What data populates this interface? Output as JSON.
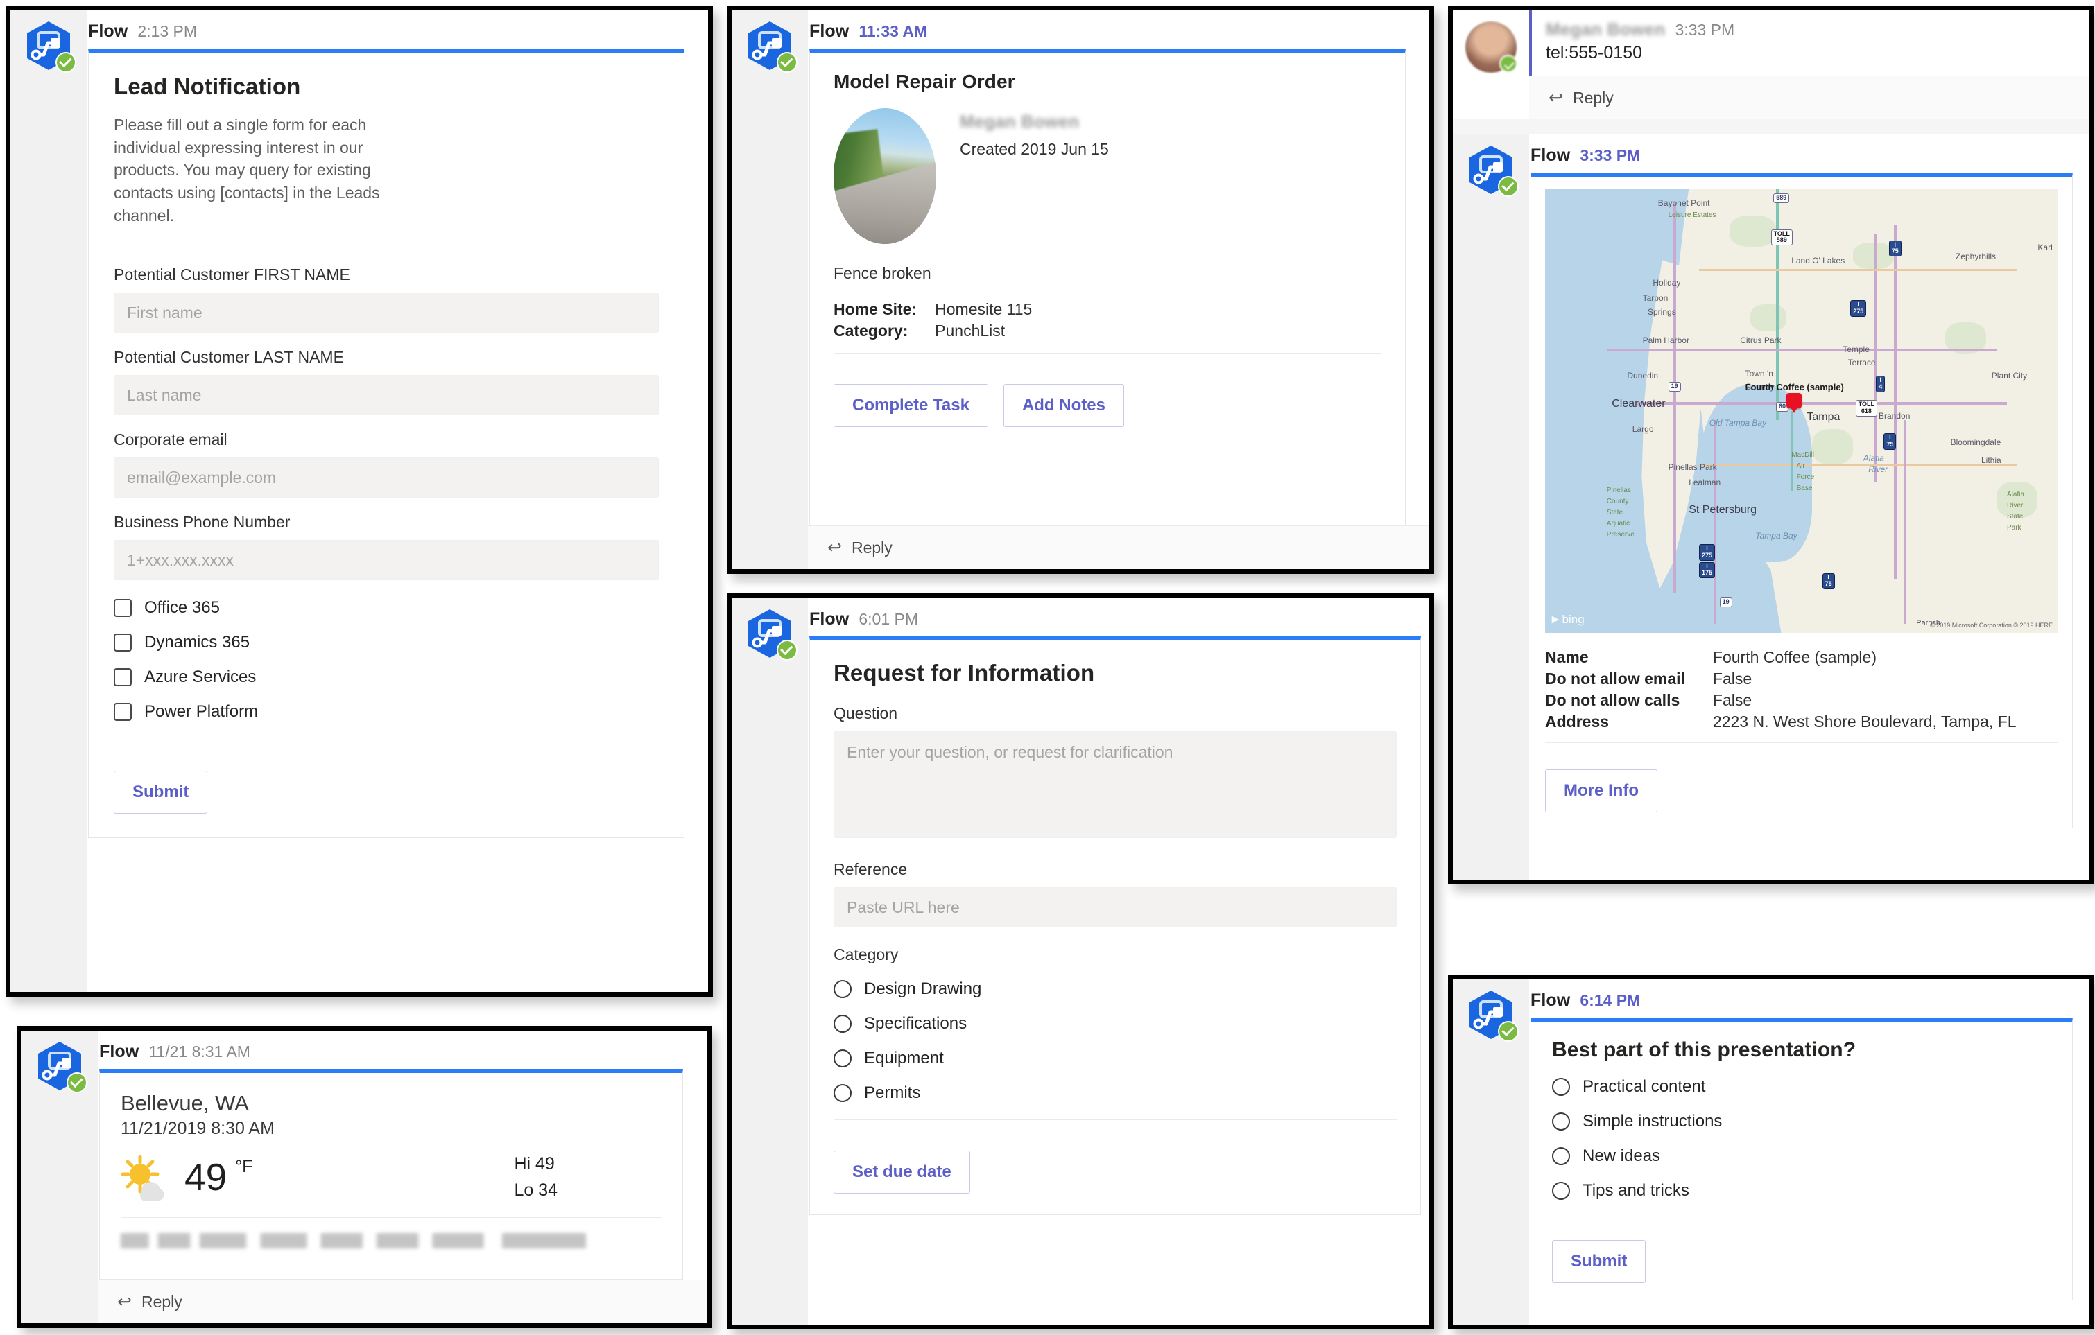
{
  "app": {
    "bot_name": "Flow",
    "bot_icon": "microsoft-flow-icon",
    "verified_badge": "green-check-badge"
  },
  "cards": {
    "lead_notification": {
      "bot_name": "Flow",
      "timestamp": "2:13 PM",
      "title": "Lead Notification",
      "description": "Please fill out a single form for each individual expressing interest in our products. You may query for existing contacts using [contacts] in the Leads channel.",
      "fields": [
        {
          "label": "Potential Customer FIRST NAME",
          "placeholder": "First name",
          "value": ""
        },
        {
          "label": "Potential Customer LAST NAME",
          "placeholder": "Last name",
          "value": ""
        },
        {
          "label": "Corporate email",
          "placeholder": "email@example.com",
          "value": ""
        },
        {
          "label": "Business Phone Number",
          "placeholder": "1+xxx.xxx.xxxx",
          "value": ""
        }
      ],
      "checkboxes": [
        {
          "label": "Office 365",
          "checked": false
        },
        {
          "label": "Dynamics 365",
          "checked": false
        },
        {
          "label": "Azure Services",
          "checked": false
        },
        {
          "label": "Power Platform",
          "checked": false
        }
      ],
      "submit_label": "Submit"
    },
    "weather": {
      "bot_name": "Flow",
      "timestamp": "11/21 8:31 AM",
      "location": "Bellevue, WA",
      "datetime": "11/21/2019 8:30 AM",
      "temperature": "49",
      "unit": "°F",
      "high": "Hi 49",
      "low": "Lo 34",
      "weather_icon": "sun-behind-cloud-icon",
      "reply_label": "Reply"
    },
    "repair_order": {
      "bot_name": "Flow",
      "timestamp": "11:33 AM",
      "title": "Model Repair Order",
      "person_name": "Megan Bowen",
      "created": "Created 2019 Jun 15",
      "issue": "Fence broken",
      "details": [
        {
          "key": "Home Site:",
          "value": "Homesite 115"
        },
        {
          "key": "Category:",
          "value": "PunchList"
        }
      ],
      "buttons": [
        "Complete Task",
        "Add Notes"
      ],
      "reply_label": "Reply"
    },
    "request_info": {
      "bot_name": "Flow",
      "timestamp": "6:01 PM",
      "title": "Request for Information",
      "question_label": "Question",
      "question_placeholder": "Enter your question, or request for clarification",
      "reference_label": "Reference",
      "reference_placeholder": "Paste URL here",
      "category_label": "Category",
      "category_options": [
        "Design Drawing",
        "Specifications",
        "Equipment",
        "Permits"
      ],
      "button_label": "Set due date"
    },
    "contact_map": {
      "message": {
        "author": "Megan Bowen",
        "timestamp": "3:33 PM",
        "text": "tel:555-0150",
        "reply_label": "Reply",
        "avatar": "user-avatar"
      },
      "bot_name": "Flow",
      "timestamp": "3:33 PM",
      "map": {
        "provider": "bing",
        "attribution": "© 2019 Microsoft Corporation © 2019 HERE",
        "pin_label": "Fourth Coffee (sample)",
        "places": [
          "Bayonet Point",
          "Leisure Estates",
          "Land O' Lakes",
          "Zephyrhills",
          "Karl",
          "Holiday",
          "Tarpon Springs",
          "Palm Harbor",
          "Citrus Park",
          "Temple Terrace",
          "Dunedin",
          "Town 'n Country",
          "Plant City",
          "Clearwater",
          "Tampa",
          "Brandon",
          "Largo",
          "Old Tampa Bay",
          "Bloomingdale",
          "Lithia",
          "Pinellas Park",
          "Lealman",
          "MacDill Air Force Base",
          "Alafia River",
          "Pinellas County State Aquatic Preserve",
          "St Petersburg",
          "Tampa Bay",
          "Alafia River State Park",
          "Parrish"
        ],
        "route_shields": [
          "589",
          "TOLL 589",
          "4",
          "275",
          "75",
          "4",
          "TOLL 618",
          "60",
          "19",
          "75",
          "275",
          "175",
          "19",
          "75"
        ]
      },
      "details": [
        {
          "key": "Name",
          "value": "Fourth Coffee (sample)"
        },
        {
          "key": "Do not allow email",
          "value": "False"
        },
        {
          "key": "Do not allow calls",
          "value": "False"
        },
        {
          "key": "Address",
          "value": "2223 N. West Shore Boulevard, Tampa, FL"
        }
      ],
      "button_label": "More Info"
    },
    "poll": {
      "bot_name": "Flow",
      "timestamp": "6:14 PM",
      "question": "Best part of this presentation?",
      "options": [
        "Practical content",
        "Simple instructions",
        "New ideas",
        "Tips and tricks"
      ],
      "submit_label": "Submit"
    }
  },
  "colors": {
    "accent_blue": "#2b7cf7",
    "button_text": "#5b5fc7",
    "bot_badge_green": "#7cbb42",
    "field_bg": "#f3f2f1",
    "gutter_bg": "#f1f1f1",
    "map_water": "#b8d4e8",
    "map_land": "#f2efe5",
    "pin_red": "#e81123"
  }
}
